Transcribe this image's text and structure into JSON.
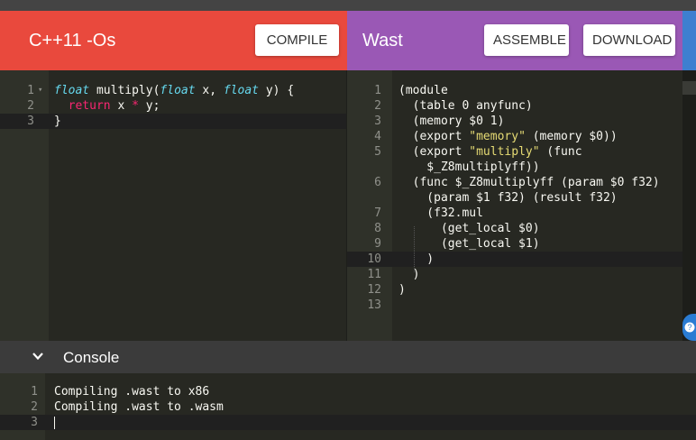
{
  "cpp_pane": {
    "title": "C++11 -Os",
    "compile_label": "COMPILE",
    "color": "#e9493d",
    "lines": [
      {
        "n": "1",
        "segments": [
          {
            "t": "float",
            "c": "kw"
          },
          {
            "t": " multiply(",
            "c": ""
          },
          {
            "t": "float",
            "c": "kw"
          },
          {
            "t": " x, ",
            "c": ""
          },
          {
            "t": "float",
            "c": "kw"
          },
          {
            "t": " y) {",
            "c": ""
          }
        ]
      },
      {
        "n": "2",
        "segments": [
          {
            "t": "  ",
            "c": ""
          },
          {
            "t": "return",
            "c": "ret"
          },
          {
            "t": " x ",
            "c": ""
          },
          {
            "t": "*",
            "c": "op"
          },
          {
            "t": " y;",
            "c": ""
          }
        ]
      },
      {
        "n": "3",
        "segments": [
          {
            "t": "}",
            "c": ""
          }
        ]
      }
    ]
  },
  "wast_pane": {
    "title": "Wast",
    "assemble_label": "ASSEMBLE",
    "download_label": "DOWNLOAD",
    "color": "#9a58b5",
    "lines": [
      {
        "n": "1",
        "text": "(module"
      },
      {
        "n": "2",
        "text": "  (table 0 anyfunc)"
      },
      {
        "n": "3",
        "text": "  (memory $0 1)"
      },
      {
        "n": "4",
        "text": "  (export \"memory\" (memory $0))"
      },
      {
        "n": "5",
        "text": "  (export \"multiply\" (func"
      },
      {
        "n": "",
        "text": "    $_Z8multiplyff))"
      },
      {
        "n": "6",
        "text": "  (func $_Z8multiplyff (param $0 f32)"
      },
      {
        "n": "",
        "text": "    (param $1 f32) (result f32)"
      },
      {
        "n": "7",
        "text": "    (f32.mul"
      },
      {
        "n": "8",
        "text": "      (get_local $0)"
      },
      {
        "n": "9",
        "text": "      (get_local $1)"
      },
      {
        "n": "10",
        "text": "    )"
      },
      {
        "n": "11",
        "text": "  )"
      },
      {
        "n": "12",
        "text": ")"
      },
      {
        "n": "13",
        "text": ""
      }
    ]
  },
  "console": {
    "title": "Console",
    "chevron_icon": "chevron-down-icon",
    "lines": [
      {
        "n": "1",
        "text": "Compiling .wast to x86"
      },
      {
        "n": "2",
        "text": "Compiling .wast to .wasm"
      },
      {
        "n": "3",
        "text": ""
      }
    ]
  },
  "help_icon": "help-icon"
}
